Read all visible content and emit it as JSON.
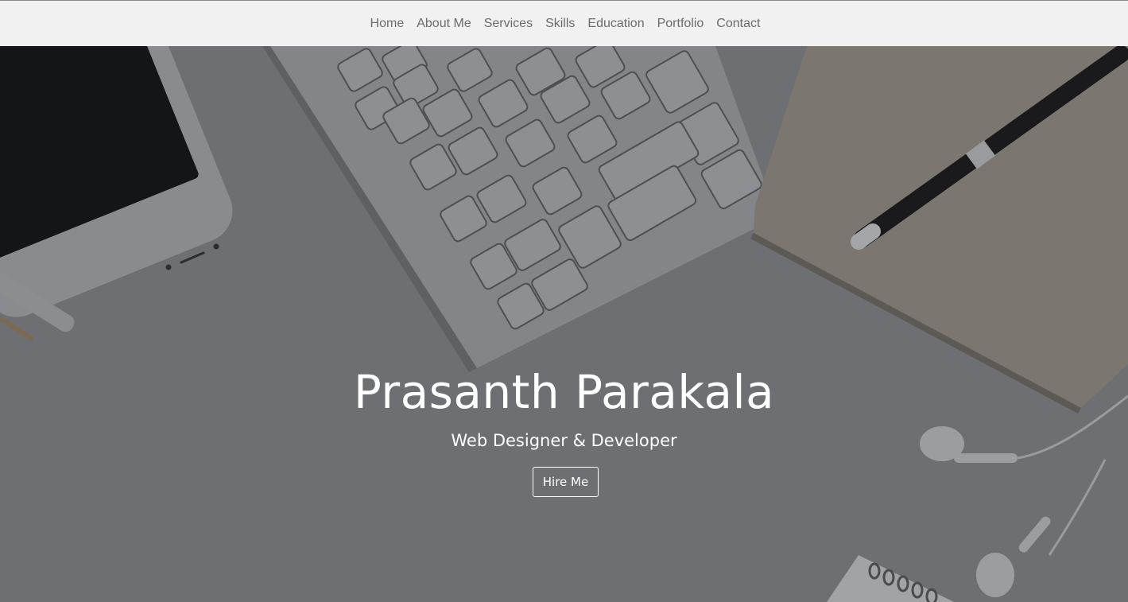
{
  "nav": {
    "items": [
      {
        "label": "Home"
      },
      {
        "label": "About Me"
      },
      {
        "label": "Services"
      },
      {
        "label": "Skills"
      },
      {
        "label": "Education"
      },
      {
        "label": "Portfolio"
      },
      {
        "label": "Contact"
      }
    ]
  },
  "hero": {
    "title": "Prasanth Parakala",
    "subtitle": "Web Designer & Developer",
    "cta_label": "Hire Me",
    "background_description_icons": [
      "phone-icon",
      "keyboard-icon",
      "notebook-icon",
      "pen-icon",
      "earphones-icon"
    ]
  },
  "colors": {
    "nav_bg": "#f1f1f1",
    "nav_text": "#6b6b6b",
    "hero_overlay": "#6e6f72",
    "hero_text": "#ffffff"
  }
}
